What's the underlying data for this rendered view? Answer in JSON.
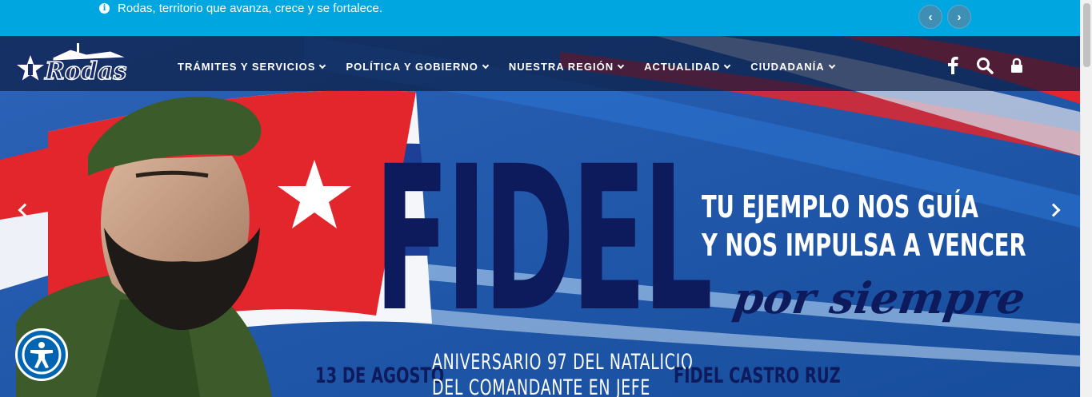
{
  "topbar": {
    "info_icon": "info-circle-icon",
    "message": "Rodas, territorio que avanza, crece y se fortalece.",
    "prev_label": "‹",
    "next_label": "›"
  },
  "nav": {
    "logo_text": "Rodas",
    "items": [
      {
        "label": "TRÁMITES Y SERVICIOS"
      },
      {
        "label": "POLÍTICA Y GOBIERNO"
      },
      {
        "label": "NUESTRA REGIÓN"
      },
      {
        "label": "ACTUALIDAD"
      },
      {
        "label": "CIUDADANÍA"
      }
    ],
    "icons": [
      "facebook-icon",
      "search-icon",
      "lock-icon"
    ]
  },
  "slide": {
    "headline": "FIDEL",
    "tagline_1": "TU EJEMPLO NOS GUÍA",
    "tagline_2": "Y NOS IMPULSA A VENCER",
    "script_text": "por siempre",
    "date": "13 DE AGOSTO",
    "anniversary_1": "ANIVERSARIO 97 DEL NATALICIO",
    "anniversary_2": "DEL COMANDANTE EN JEFE",
    "name": "FIDEL CASTRO RUZ"
  },
  "colors": {
    "topbar": "#00a6e0",
    "navy": "#0d1a5c",
    "flag_red": "#e3262c",
    "accessibility": "#0064b0"
  }
}
